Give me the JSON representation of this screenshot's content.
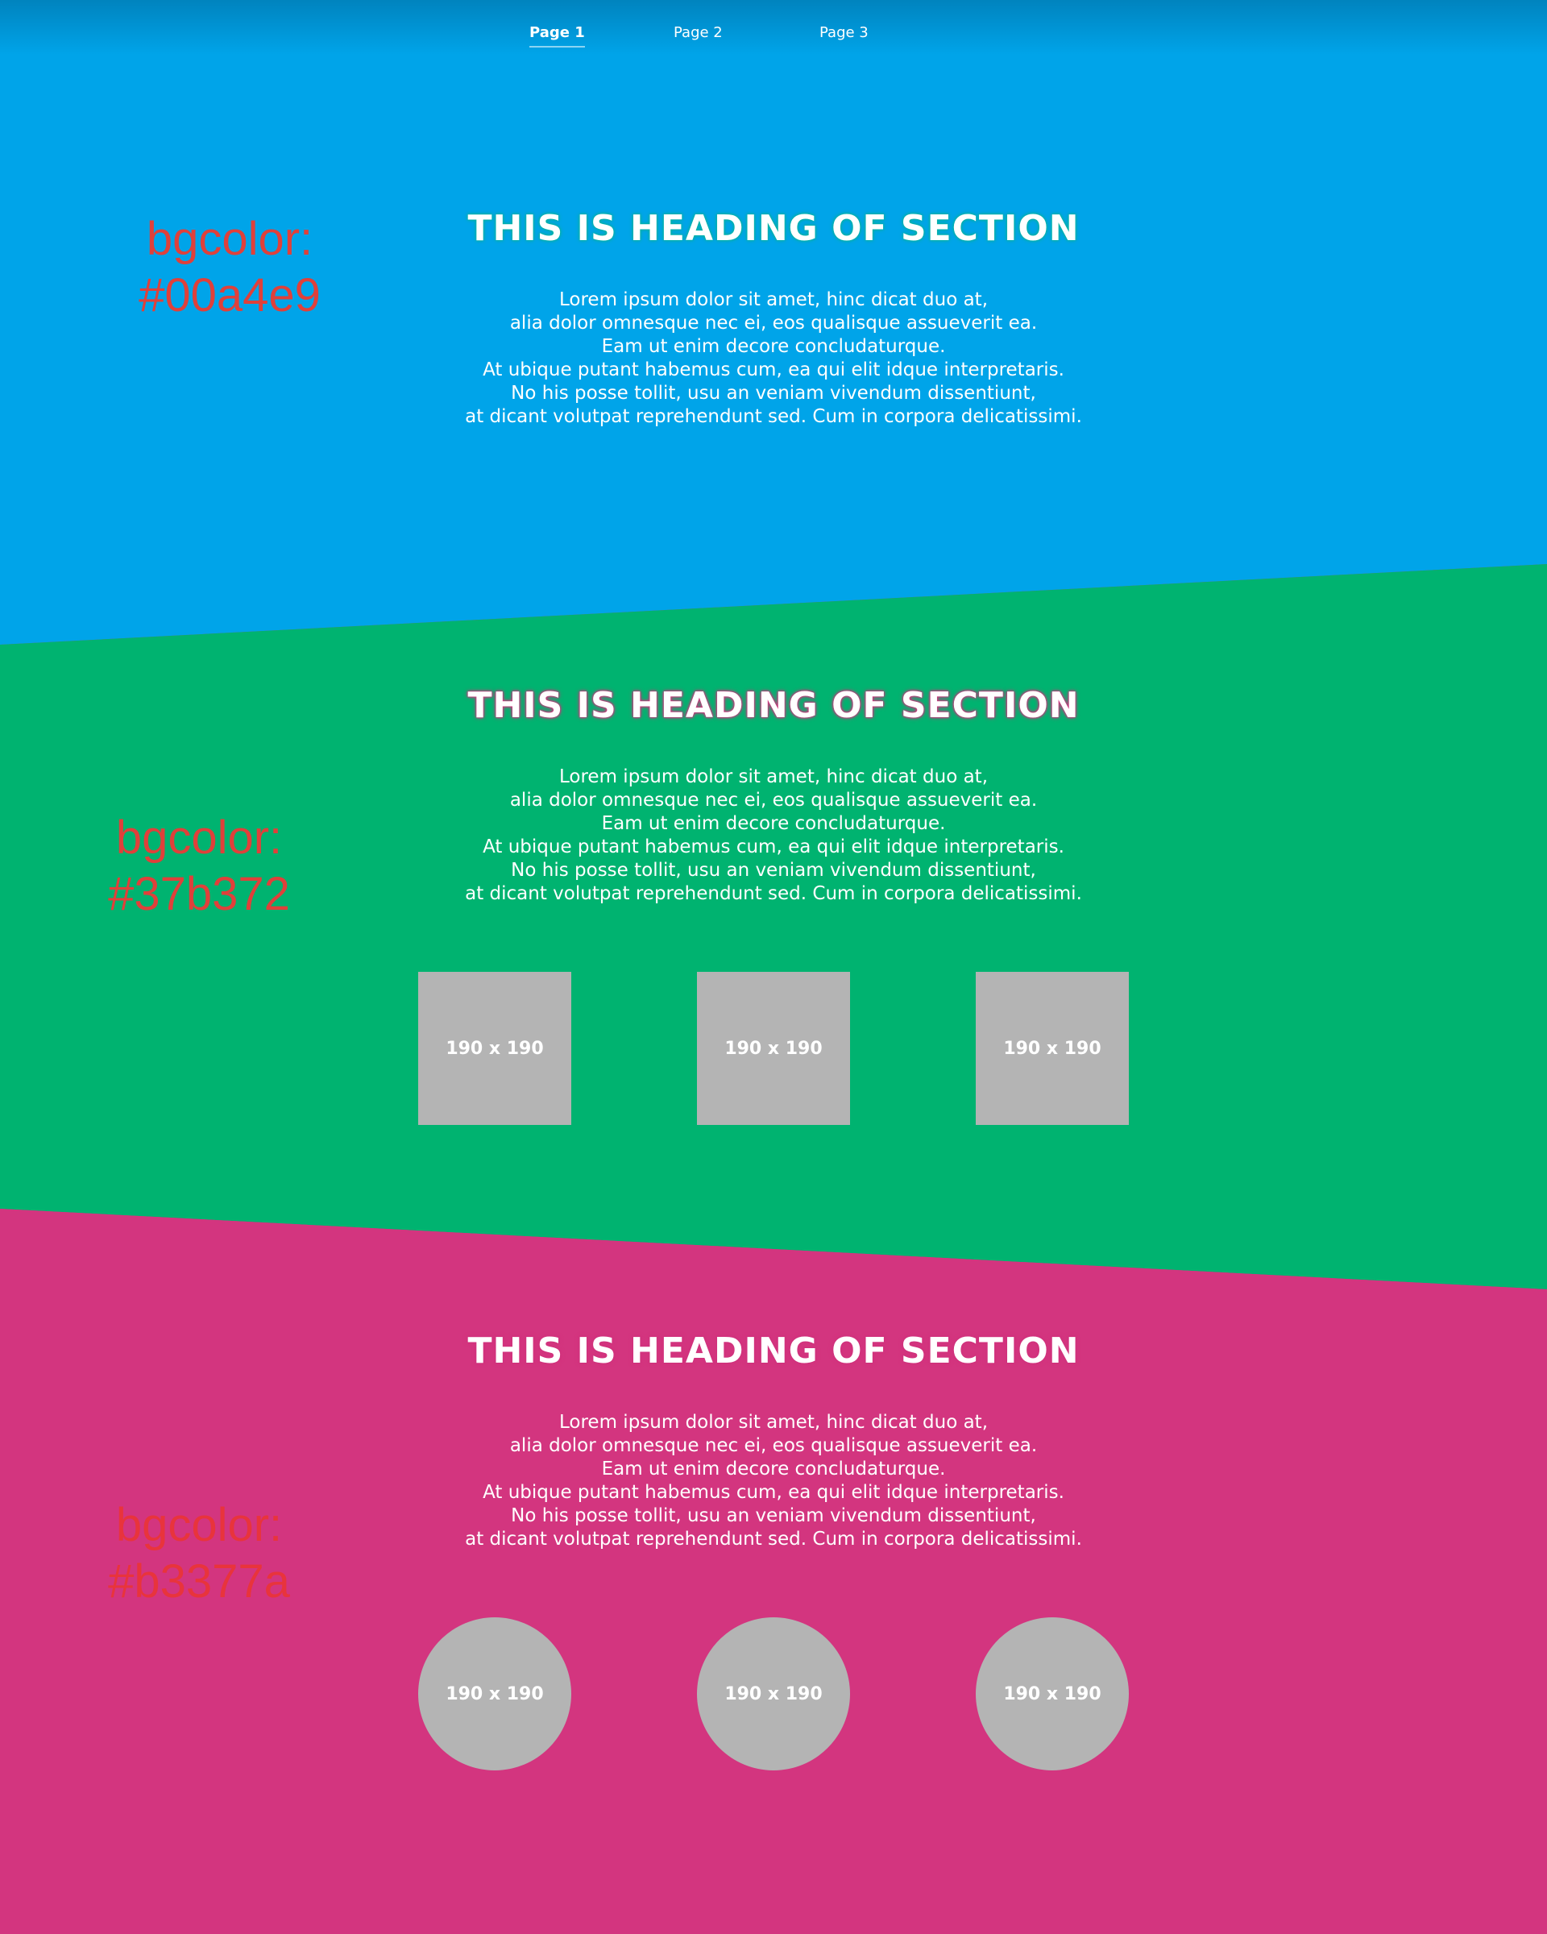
{
  "nav": {
    "items": [
      {
        "label": "Page 1",
        "active": true
      },
      {
        "label": "Page 2",
        "active": false
      },
      {
        "label": "Page 3",
        "active": false
      }
    ]
  },
  "sections": [
    {
      "heading": "THIS IS HEADING OF SECTION",
      "lines": [
        "Lorem ipsum dolor sit amet, hinc dicat duo at,",
        "alia dolor omnesque nec ei, eos qualisque assueverit ea.",
        "Eam ut enim decore concludaturque.",
        "At ubique putant habemus cum, ea qui elit idque interpretaris.",
        "No his posse tollit, usu an veniam vivendum dissentiunt,",
        "at dicant volutpat reprehendunt sed. Cum in corpora delicatissimi."
      ],
      "note": {
        "label": "bgcolor:",
        "value": "#00a4e9"
      },
      "bg_color": "#00a4e9"
    },
    {
      "heading": "THIS IS HEADING OF SECTION",
      "lines": [
        "Lorem ipsum dolor sit amet, hinc dicat duo at,",
        "alia dolor omnesque nec ei, eos qualisque assueverit ea.",
        "Eam ut enim decore concludaturque.",
        "At ubique putant habemus cum, ea qui elit idque interpretaris.",
        "No his posse tollit, usu an veniam vivendum dissentiunt,",
        "at dicant volutpat reprehendunt sed. Cum in corpora delicatissimi."
      ],
      "note": {
        "label": "bgcolor:",
        "value": "#37b372"
      },
      "bg_color": "#00b370",
      "images": [
        "190 x 190",
        "190 x 190",
        "190 x 190"
      ]
    },
    {
      "heading": "THIS IS HEADING OF SECTION",
      "lines": [
        "Lorem ipsum dolor sit amet, hinc dicat duo at,",
        "alia dolor omnesque nec ei, eos qualisque assueverit ea.",
        "Eam ut enim decore concludaturque.",
        "At ubique putant habemus cum, ea qui elit idque interpretaris.",
        "No his posse tollit, usu an veniam vivendum dissentiunt,",
        "at dicant volutpat reprehendunt sed. Cum in corpora delicatissimi."
      ],
      "note": {
        "label": "bgcolor:",
        "value": "#b3377a"
      },
      "bg_color": "#d3357f",
      "images": [
        "190 x 190",
        "190 x 190",
        "190 x 190"
      ]
    }
  ]
}
